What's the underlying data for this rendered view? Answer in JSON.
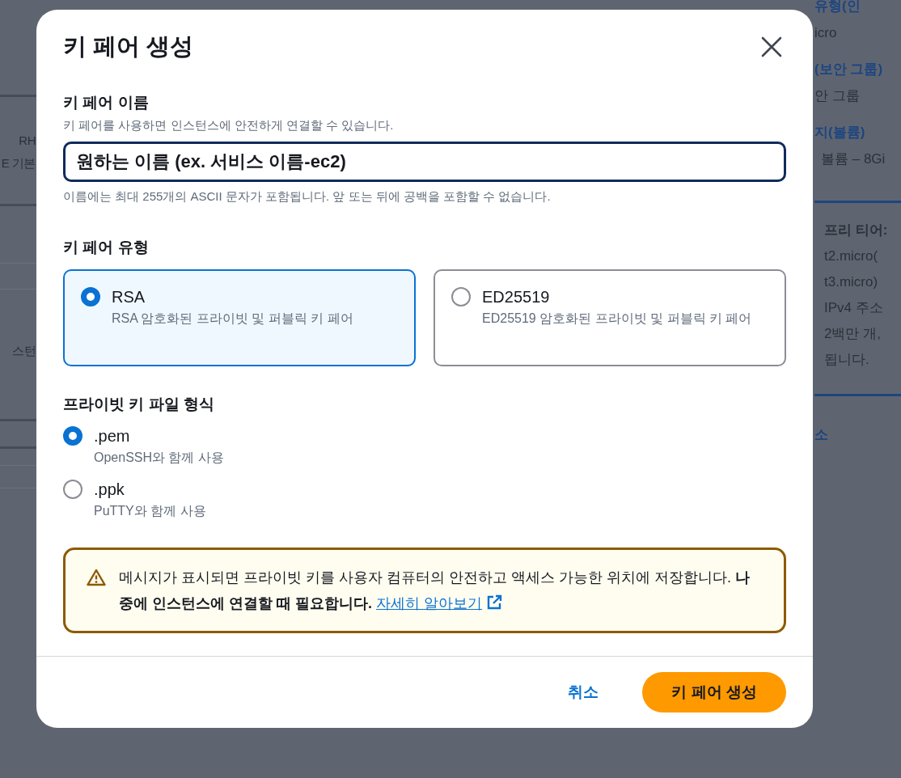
{
  "background": {
    "left": [
      {
        "kind": "text",
        "text": "RH"
      },
      {
        "kind": "text",
        "text": "E 기본"
      },
      {
        "kind": "text",
        "text": "스턴"
      }
    ],
    "right": [
      {
        "kind": "heading",
        "text": "유형(인"
      },
      {
        "kind": "text",
        "text": "icro"
      },
      {
        "kind": "heading",
        "text": "(보안 그룹)"
      },
      {
        "kind": "text",
        "text": "안 그룹"
      },
      {
        "kind": "heading",
        "text": "지(볼륨)"
      },
      {
        "kind": "text",
        "text": "볼륨 – 8Gi"
      },
      {
        "kind": "info",
        "lines": [
          "프리 티어:",
          "t2.micro(",
          "t3.micro)",
          "IPv4 주소",
          "2백만 개,",
          "됩니다."
        ]
      },
      {
        "kind": "heading",
        "text": "소"
      }
    ]
  },
  "modal": {
    "title": "키 페어 생성",
    "name_field": {
      "label": "키 페어 이름",
      "description": "키 페어를 사용하면 인스턴스에 안전하게 연결할 수 있습니다.",
      "value": "원하는 이름 (ex. 서비스 이름-ec2)",
      "hint": "이름에는 최대 255개의 ASCII 문자가 포함됩니다. 앞 또는 뒤에 공백을 포함할 수 없습니다."
    },
    "type_section": {
      "label": "키 페어 유형",
      "options": [
        {
          "title": "RSA",
          "description": "RSA 암호화된 프라이빗 및 퍼블릭 키 페어",
          "selected": true
        },
        {
          "title": "ED25519",
          "description": "ED25519 암호화된 프라이빗 및 퍼블릭 키 페어",
          "selected": false
        }
      ]
    },
    "format_section": {
      "label": "프라이빗 키 파일 형식",
      "options": [
        {
          "title": ".pem",
          "description": "OpenSSH와 함께 사용",
          "selected": true
        },
        {
          "title": ".ppk",
          "description": "PuTTY와 함께 사용",
          "selected": false
        }
      ]
    },
    "alert": {
      "text": "메시지가 표시되면 프라이빗 키를 사용자 컴퓨터의 안전하고 액세스 가능한 위치에 저장합니다. **나중에 인스턴스에 연결할 때 필요합니다.**",
      "link": "자세히 알아보기"
    },
    "buttons": {
      "cancel": "취소",
      "primary": "키 페어 생성"
    }
  }
}
